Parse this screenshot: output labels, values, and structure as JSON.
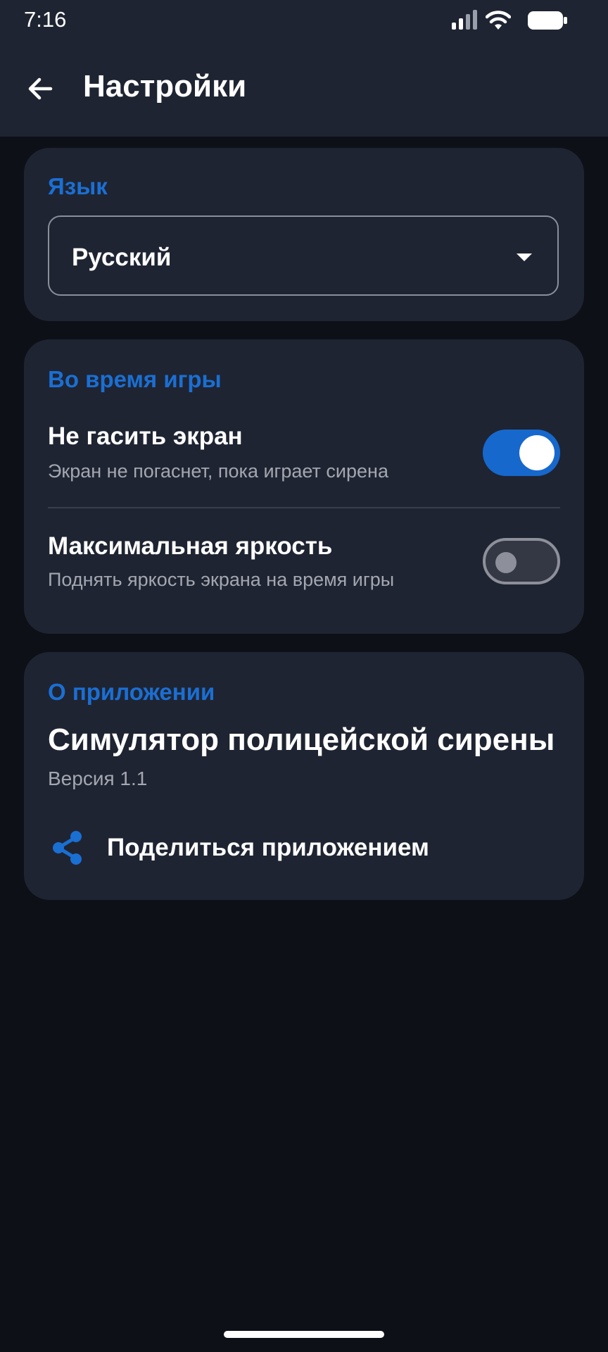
{
  "status_bar": {
    "time": "7:16",
    "icons": [
      "signal-icon",
      "wifi-icon",
      "battery-icon"
    ]
  },
  "app_bar": {
    "back_icon": "arrow-back-icon",
    "title": "Настройки"
  },
  "language": {
    "section_title": "Язык",
    "selected": "Русский"
  },
  "during_game": {
    "section_title": "Во время игры",
    "keep_screen_on": {
      "title": "Не гасить экран",
      "subtitle": "Экран не погаснет, пока играет сирена",
      "enabled": true
    },
    "max_brightness": {
      "title": "Максимальная яркость",
      "subtitle": "Поднять яркость экрана на время игры",
      "enabled": false
    }
  },
  "about": {
    "section_title": "О приложении",
    "app_name": "Симулятор полицейской сирены",
    "version": "Версия 1.1",
    "share_label": "Поделиться приложением",
    "share_icon": "share-icon"
  },
  "colors": {
    "accent": "#1a6fd3",
    "card": "#1f2432",
    "background": "#0d1016",
    "switch_on": "#1768cc"
  }
}
